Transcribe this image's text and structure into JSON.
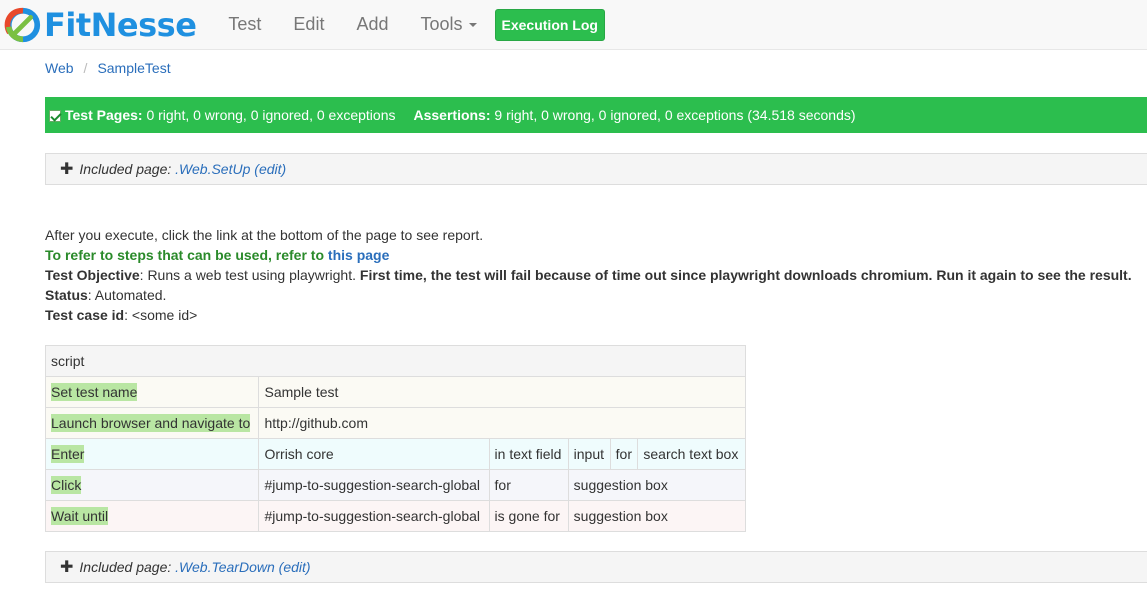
{
  "brand": {
    "name": "FitNesse",
    "logo_icon": "fitnesse-logo-icon"
  },
  "nav": {
    "items": [
      "Test",
      "Edit",
      "Add",
      "Tools"
    ],
    "execution_log": "Execution Log"
  },
  "breadcrumb": {
    "items": [
      "Web",
      "SampleTest"
    ],
    "separator": "/"
  },
  "summary": {
    "test_pages_label": "Test Pages:",
    "test_pages_value": "0 right, 0 wrong, 0 ignored, 0 exceptions",
    "assertions_label": "Assertions:",
    "assertions_value": "9 right, 0 wrong, 0 ignored, 0 exceptions (34.518 seconds)",
    "status_color": "#2cbe4e"
  },
  "setup": {
    "prefix": "Included page:",
    "link": ".Web.SetUp",
    "edit": "(edit)"
  },
  "teardown": {
    "prefix": "Included page:",
    "link": ".Web.TearDown",
    "edit": "(edit)"
  },
  "content": {
    "line1": "After you execute, click the link at the bottom of the page to see report.",
    "line2_text": "To refer to steps that can be used, refer to",
    "line2_link": "this page",
    "objective_label": "Test Objective",
    "objective_text": ": Runs a web test using playwright.",
    "objective_bold": "First time, the test will fail because of time out since playwright downloads chromium. Run it again to see the result.",
    "status_label": "Status",
    "status_text": ": Automated.",
    "caseid_label": "Test case id",
    "caseid_text": ": <some id>"
  },
  "table": {
    "header": "script",
    "rows": [
      [
        "Set test name",
        "Sample test"
      ],
      [
        "Launch browser and navigate to",
        "http://github.com"
      ],
      [
        "Enter",
        "Orrish core",
        "in text field",
        "input",
        "for",
        "search text box"
      ],
      [
        "Click",
        "#jump-to-suggestion-search-global",
        "for",
        "suggestion box"
      ],
      [
        "Wait until",
        "#jump-to-suggestion-search-global",
        "is gone for",
        "suggestion box"
      ]
    ]
  }
}
